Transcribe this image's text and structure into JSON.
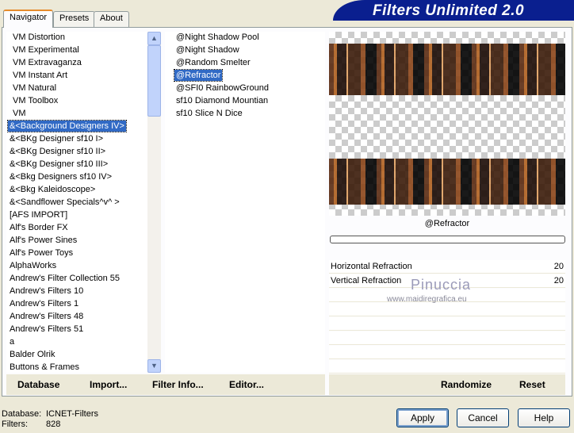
{
  "title": "Filters Unlimited 2.0",
  "tabs": [
    {
      "label": "Navigator",
      "active": true
    },
    {
      "label": "Presets"
    },
    {
      "label": "About"
    }
  ],
  "categories": {
    "items": [
      "VM Distortion",
      "VM Experimental",
      "VM Extravaganza",
      "VM Instant Art",
      "VM Natural",
      "VM Toolbox",
      "VM",
      "&<Background Designers IV>",
      "&<BKg Designer sf10 I>",
      "&<BKg Designer sf10 II>",
      "&<BKg Designer sf10 III>",
      "&<Bkg Designers sf10 IV>",
      "&<Bkg Kaleidoscope>",
      "&<Sandflower Specials^v^ >",
      "[AFS IMPORT]",
      "Alf's Border FX",
      "Alf's Power Sines",
      "Alf's Power Toys",
      "AlphaWorks",
      "Andrew's Filter Collection 55",
      "Andrew's Filters 10",
      "Andrew's Filters 1",
      "Andrew's Filters 48",
      "Andrew's Filters 51",
      "a",
      "Balder Olrik",
      "Buttons & Frames"
    ],
    "selected": 7
  },
  "filters": {
    "items": [
      "@Night Shadow Pool",
      "@Night Shadow",
      "@Random Smelter",
      "@Refractor",
      "@SFI0 RainbowGround",
      "sf10 Diamond Mountian",
      "sf10 Slice N Dice"
    ],
    "selected": 3
  },
  "preview": {
    "filter_name": "@Refractor",
    "progress": 0
  },
  "params": [
    {
      "label": "Horizontal Refraction",
      "value": "20"
    },
    {
      "label": "Vertical Refraction",
      "value": "20"
    }
  ],
  "watermark": {
    "name": "Pinuccia",
    "url": "www.maidiregrafica.eu"
  },
  "toolbar": {
    "database": "Database",
    "import": "Import...",
    "filter_info": "Filter Info...",
    "editor": "Editor...",
    "randomize": "Randomize",
    "reset": "Reset"
  },
  "status": {
    "database_label": "Database:",
    "database_value": "ICNET-Filters",
    "filters_label": "Filters:",
    "filters_value": "828"
  },
  "buttons": {
    "apply": "Apply",
    "cancel": "Cancel",
    "help": "Help"
  }
}
